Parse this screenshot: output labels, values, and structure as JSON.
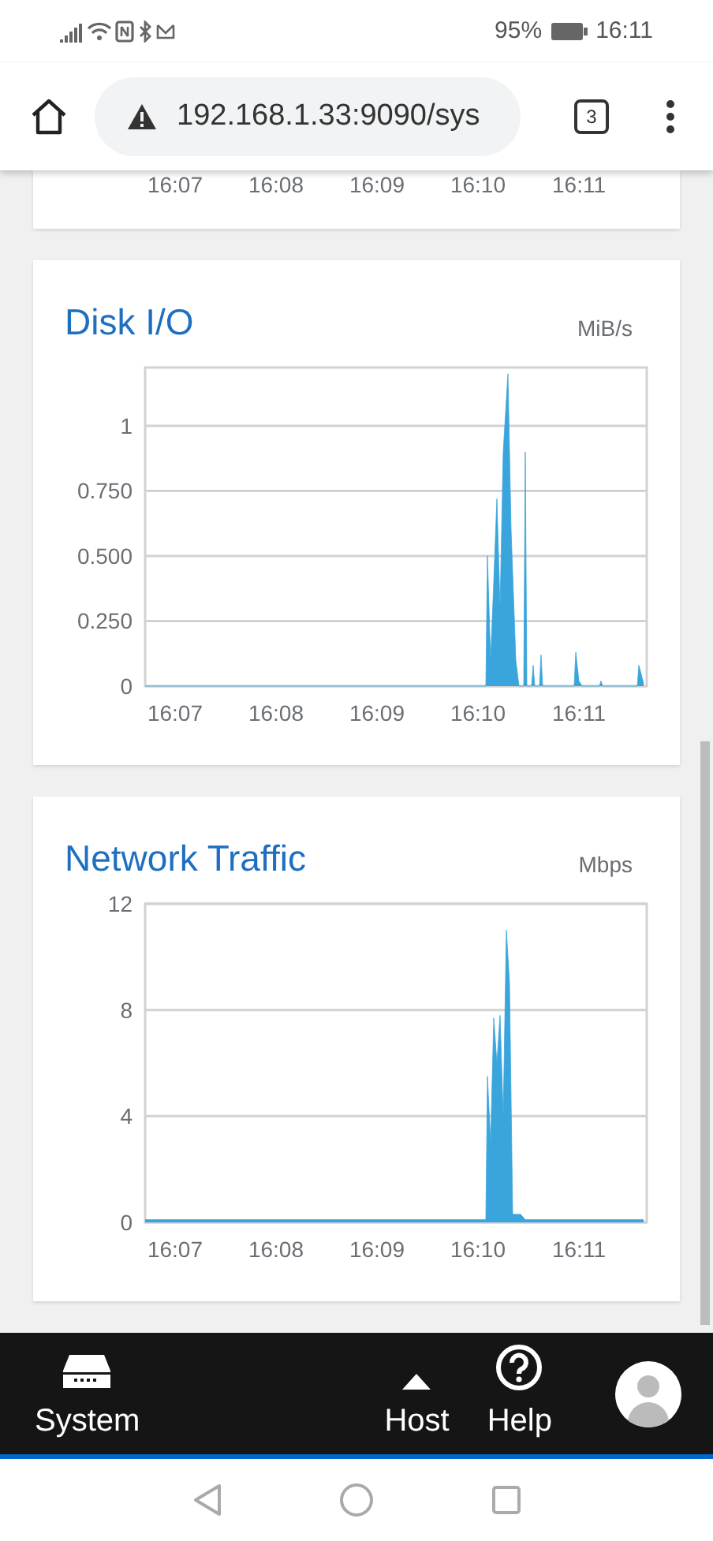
{
  "status_bar": {
    "battery": "95%",
    "time": "16:11"
  },
  "browser": {
    "url": "192.168.1.33:9090/sys",
    "tab_count": "3"
  },
  "partial_card": {
    "xtick_labels": [
      "16:07",
      "16:08",
      "16:09",
      "16:10",
      "16:11"
    ]
  },
  "cards": [
    {
      "title": "Disk I/O",
      "unit": "MiB/s",
      "chart_data": {
        "type": "area",
        "x": [
          966.703,
          970.078,
          970.094,
          970.125,
          970.156,
          970.188,
          970.219,
          970.25,
          970.297,
          970.328,
          970.375,
          970.406,
          970.453,
          970.469,
          970.484,
          970.531,
          970.547,
          970.563,
          970.609,
          970.625,
          970.641,
          970.953,
          970.969,
          971.0,
          971.031,
          971.203,
          971.219,
          971.234,
          971.578,
          971.594,
          971.641
        ],
        "series": [
          {
            "color": "#39a5dc",
            "values": [
              0,
              0,
              0.5,
              0.1,
              0.4,
              0.72,
              0.3,
              0.9,
              1.2,
              0.6,
              0.1,
              0,
              0,
              0.9,
              0,
              0,
              0.08,
              0,
              0,
              0.12,
              0,
              0,
              0.13,
              0.02,
              0,
              0,
              0.02,
              0,
              0,
              0.08,
              0.01
            ]
          }
        ],
        "xlim": [
          966.703,
          971.672
        ],
        "ylim": [
          0,
          1.224
        ],
        "grid": true,
        "xticks": [
          {
            "value": 967,
            "label": "16:07"
          },
          {
            "value": 968,
            "label": "16:08"
          },
          {
            "value": 969,
            "label": "16:09"
          },
          {
            "value": 970,
            "label": "16:10"
          },
          {
            "value": 971,
            "label": "16:11"
          }
        ],
        "yticks": [
          {
            "value": 0,
            "label": "0"
          },
          {
            "value": 0.25,
            "label": "0.250"
          },
          {
            "value": 0.5,
            "label": "0.500"
          },
          {
            "value": 0.75,
            "label": "0.750"
          },
          {
            "value": 1,
            "label": "1"
          }
        ]
      }
    },
    {
      "title": "Network Traffic",
      "unit": "Mbps",
      "chart_data": {
        "type": "area",
        "x": [
          966.703,
          970.078,
          970.094,
          970.125,
          970.156,
          970.188,
          970.219,
          970.25,
          970.281,
          970.313,
          970.344,
          970.422,
          970.469,
          971.641
        ],
        "series": [
          {
            "color": "#39a5dc",
            "values": [
              0.1,
              0.1,
              5.5,
              3,
              7.7,
              6,
              7.8,
              4,
              11,
              9,
              0.3,
              0.3,
              0.1,
              0.1
            ]
          }
        ],
        "xlim": [
          966.703,
          971.672
        ],
        "ylim": [
          0,
          12
        ],
        "grid": true,
        "xticks": [
          {
            "value": 967,
            "label": "16:07"
          },
          {
            "value": 968,
            "label": "16:08"
          },
          {
            "value": 969,
            "label": "16:09"
          },
          {
            "value": 970,
            "label": "16:10"
          },
          {
            "value": 971,
            "label": "16:11"
          }
        ],
        "yticks": [
          0,
          4,
          8,
          12
        ]
      }
    }
  ],
  "nav": {
    "items": [
      {
        "label": "System",
        "kind": "system"
      },
      {
        "label": "Host",
        "kind": "host"
      },
      {
        "label": "Help",
        "kind": "help"
      }
    ]
  }
}
